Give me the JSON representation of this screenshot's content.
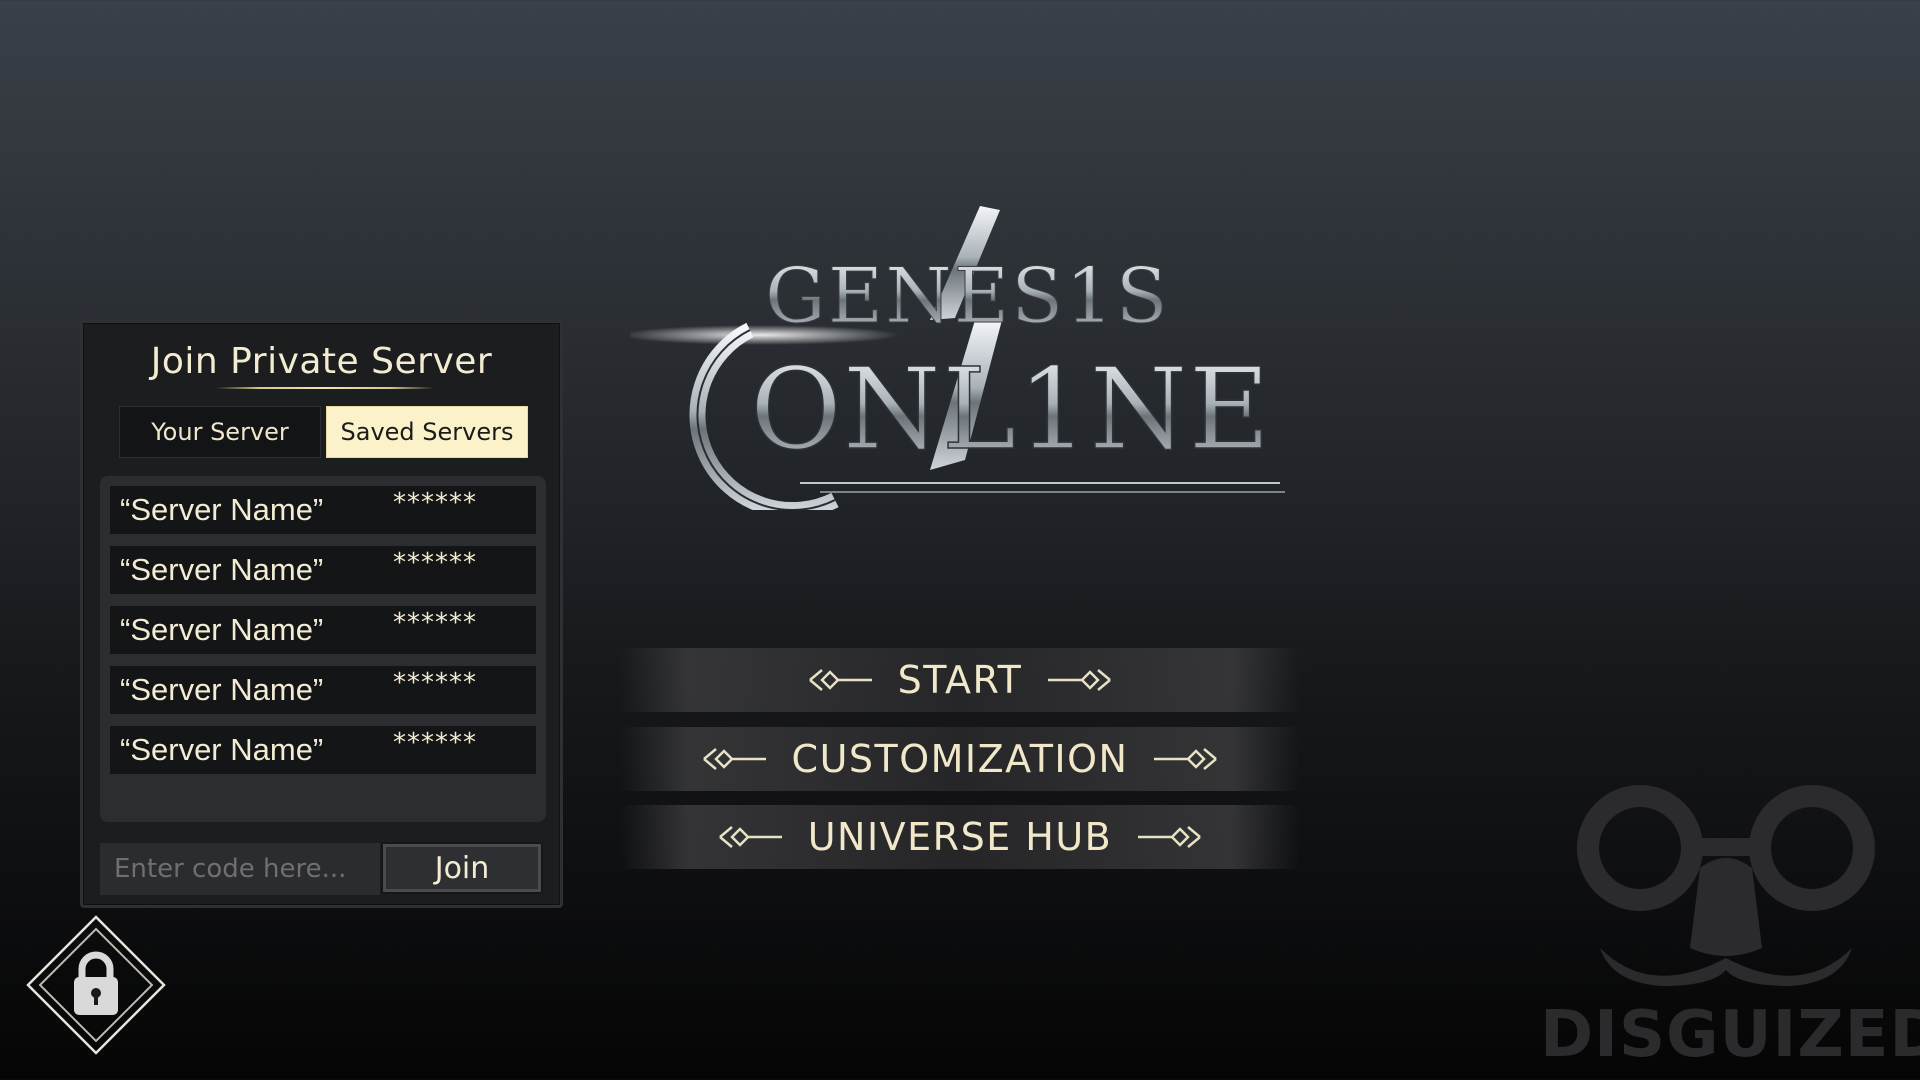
{
  "logo": {
    "line1": "GENES1S",
    "line2": "ONL1NE"
  },
  "panel": {
    "title": "Join Private Server",
    "tabs": [
      {
        "label": "Your Server",
        "selected": false
      },
      {
        "label": "Saved Servers",
        "selected": true
      }
    ],
    "servers": [
      {
        "name": "“Server Name”",
        "code": "******"
      },
      {
        "name": "“Server Name”",
        "code": "******"
      },
      {
        "name": "“Server Name”",
        "code": "******"
      },
      {
        "name": "“Server Name”",
        "code": "******"
      },
      {
        "name": "“Server Name”",
        "code": "******"
      }
    ],
    "code_input": {
      "value": "",
      "placeholder": "Enter code here..."
    },
    "join_label": "Join"
  },
  "menu": {
    "start": "START",
    "customization": "CUSTOMIZATION",
    "universe_hub": "UNIVERSE HUB"
  },
  "lock_icon": "padlock-icon",
  "watermark": {
    "text": "DISGUIZED",
    "icon": "disguise-glasses-mustache-icon"
  },
  "colors": {
    "accent_cream": "#fbf2c9",
    "text_cream": "#f3ebd3",
    "panel_bg": "#1c1d1f"
  }
}
